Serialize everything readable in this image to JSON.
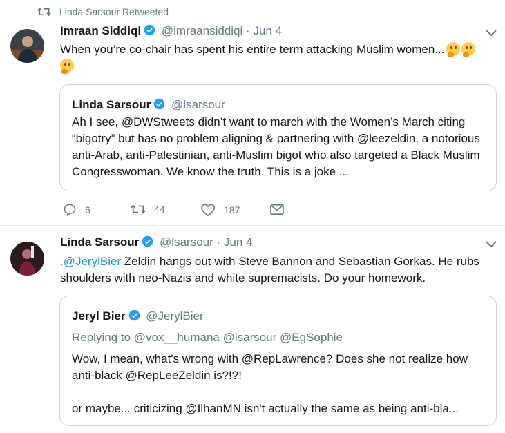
{
  "retweet_banner": {
    "text": "Linda Sarsour Retweeted"
  },
  "tweet1": {
    "name": "Imraan Siddiqi",
    "handle": "@imraansiddiqi",
    "dot": "·",
    "date": "Jun 4",
    "text": "When you’re co-chair has spent his entire term attacking Muslim women...",
    "emojis": [
      "thinking-face-emoji",
      "thinking-face-emoji",
      "thinking-face-emoji"
    ],
    "quote": {
      "name": "Linda Sarsour",
      "handle": "@lsarsour",
      "text": "Ah I see, @DWStweets didn’t want to march with the Women’s March citing “bigotry” but has no problem aligning & partnering with @leezeldin, a notorious anti-Arab, anti-Palestinian, anti-Muslim bigot who also targeted a Black Muslim Congresswoman. We know the truth. This is a joke ..."
    },
    "actions": {
      "replies": "6",
      "retweets": "44",
      "likes": "187"
    }
  },
  "tweet2": {
    "name": "Linda Sarsour",
    "handle": "@lsarsour",
    "dot": "·",
    "date": "Jun 4",
    "mention": ".@JerylBier",
    "text": " Zeldin hangs out with Steve Bannon and Sebastian Gorkas. He rubs shoulders with neo-Nazis and white supremacists. Do your homework.",
    "quote": {
      "name": "Jeryl Bier",
      "handle": "@JerylBier",
      "replying_prefix": "Replying to",
      "replying_to": "@vox__humana @lsarsour @EgSophie",
      "line1": "Wow, I mean, what's wrong with @RepLawrence? Does she not realize how anti-black @RepLeeZeldin is?!?!",
      "line2": "or maybe... criticizing @IlhanMN isn't actually the same as being anti-bla..."
    }
  },
  "colors": {
    "accent": "#1da1f2",
    "muted": "#657786",
    "text": "#14171a",
    "border": "#ccd6dd"
  }
}
